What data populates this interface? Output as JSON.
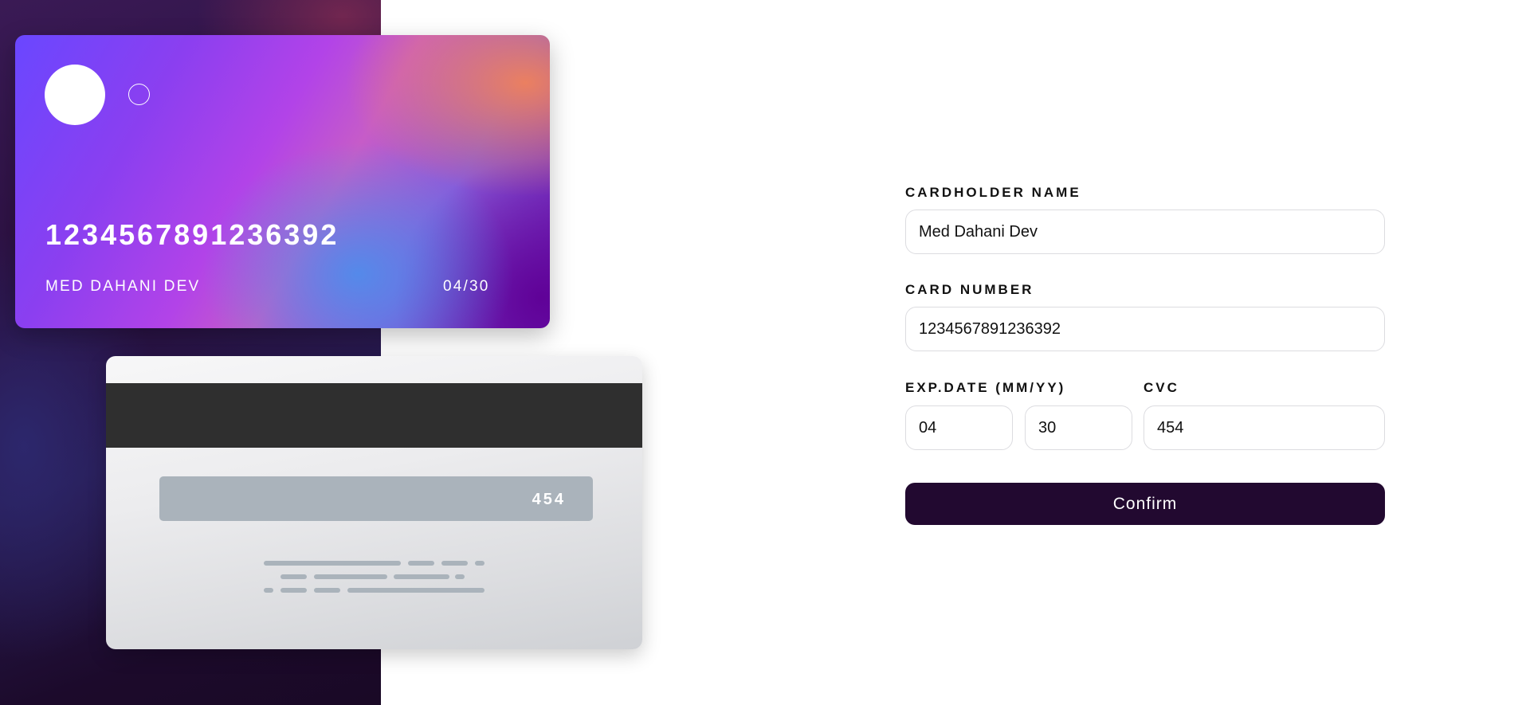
{
  "card_front": {
    "number": "1234567891236392",
    "name": "MED DAHANI DEV",
    "expiry": "04/30"
  },
  "card_back": {
    "cvc": "454"
  },
  "form": {
    "cardholder_label": "CARDHOLDER NAME",
    "cardholder_value": "Med Dahani Dev",
    "card_number_label": "CARD NUMBER",
    "card_number_value": "1234567891236392",
    "exp_label": "EXP.DATE (MM/YY)",
    "exp_month_value": "04",
    "exp_year_value": "30",
    "cvc_label": "CVC",
    "cvc_value": "454",
    "confirm_label": "Confirm"
  },
  "colors": {
    "button_bg": "#220930",
    "panel_dark": "#1a0926",
    "cvc_box": "#aab3bb"
  }
}
